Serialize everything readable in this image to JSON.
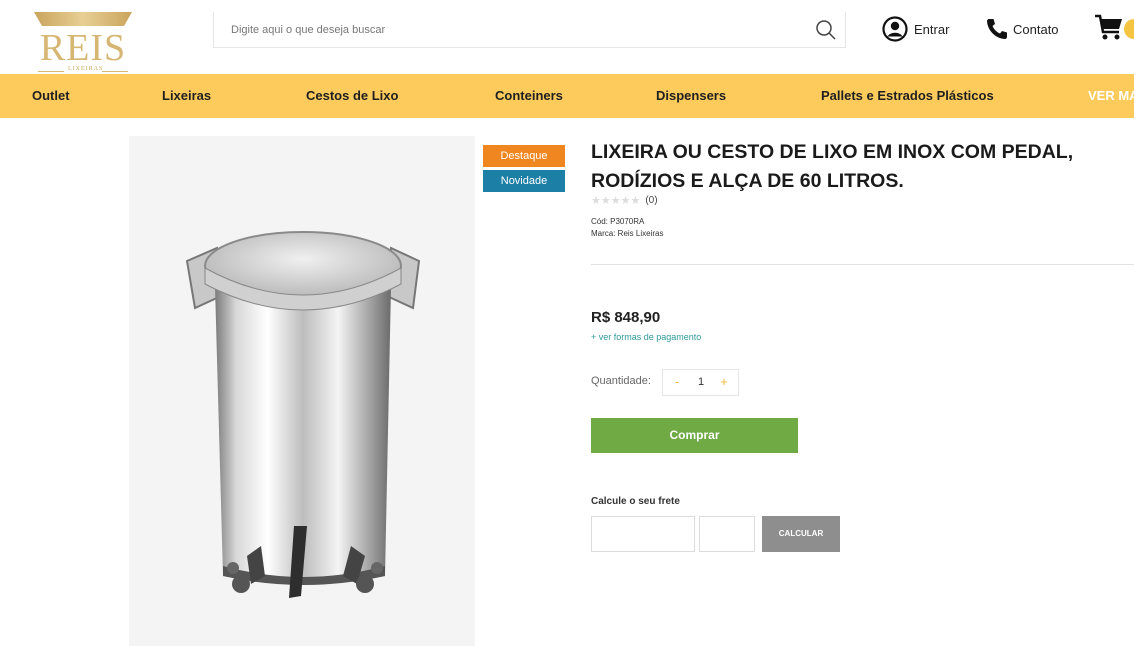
{
  "brand": {
    "name": "REIS",
    "subtitle": "LIXEIRAS",
    "gold": "#d6b673"
  },
  "search": {
    "placeholder": "Digite aqui o que deseja buscar",
    "icon": "search-icon"
  },
  "header": {
    "login_label": "Entrar",
    "login_icon": "user-circle-icon",
    "contact_label": "Contato",
    "contact_icon": "phone-icon",
    "cart_icon": "cart-icon"
  },
  "nav": {
    "background": "#fccb5c",
    "items": [
      {
        "label": "Outlet"
      },
      {
        "label": "Lixeiras"
      },
      {
        "label": "Cestos de Lixo"
      },
      {
        "label": "Conteiners"
      },
      {
        "label": "Dispensers"
      },
      {
        "label": "Pallets e Estrados Plásticos"
      },
      {
        "label": "VER MA"
      }
    ]
  },
  "product": {
    "badges": [
      {
        "label": "Destaque",
        "color": "#f0861f"
      },
      {
        "label": "Novidade",
        "color": "#1c7fa6"
      }
    ],
    "title": "LIXEIRA OU CESTO DE LIXO EM INOX COM PEDAL, RODÍZIOS E ALÇA DE 60 LITROS.",
    "rating": {
      "stars": 0,
      "max": 5,
      "count_label": "(0)"
    },
    "code": "Cód: P3070RA",
    "brand": "Marca: Reis Lixeiras",
    "price": "R$ 848,90",
    "payment_link": "+ ver formas de pagamento",
    "quantity_label": "Quantidade:",
    "quantity": "1",
    "minus": "-",
    "plus": "+",
    "buy_label": "Comprar",
    "buy_color": "#6faa45"
  },
  "shipping": {
    "label": "Calcule o seu frete",
    "button": "CALCULAR"
  }
}
